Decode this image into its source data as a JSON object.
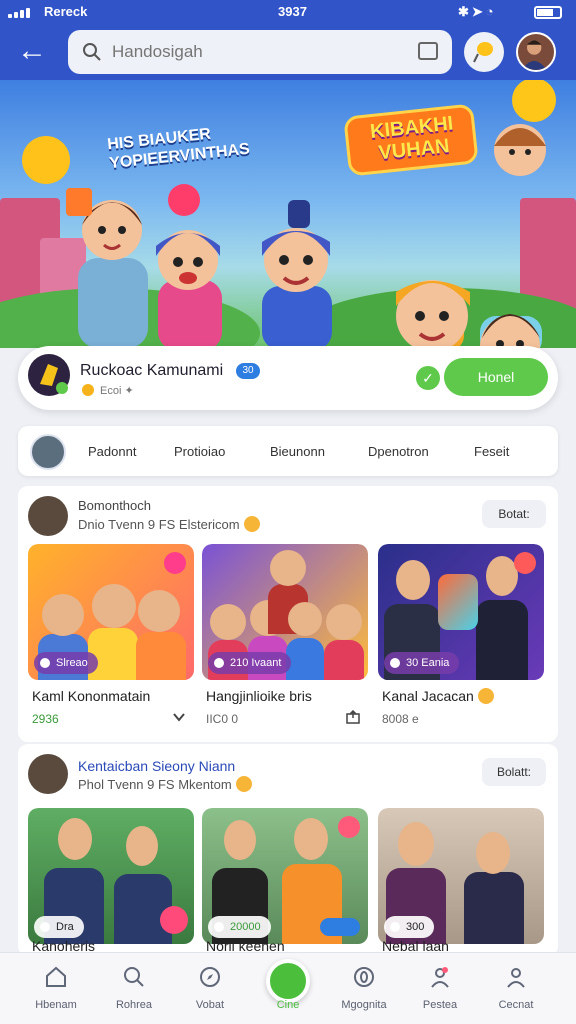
{
  "status_bar": {
    "carrier": "Rereck",
    "time": "3937"
  },
  "header": {
    "search_placeholder": "Handosigah"
  },
  "banner": {
    "promo_text": "HIS BIAUKER\nYOPIEERVINTHAS",
    "logo_text": "KIBAKHI\nVUHAN"
  },
  "channel": {
    "name": "Ruckoac Kamunami",
    "badge": "30",
    "subtitle": "Ecoi ✦",
    "follow_label": "Honel"
  },
  "tabs": [
    "Padonnt",
    "Protioiao",
    "Bieunonn",
    "Dpenotron",
    "Feseit"
  ],
  "feed": [
    {
      "title": "Bomonthoch",
      "subtitle": "Dnio Tvenn 9 FS Elstericom",
      "action": "Botat:",
      "videos": [
        {
          "badge": "Slreao",
          "title": "Kaml Kononmatain",
          "meta": "2936",
          "meta_color": "#3a9b3a"
        },
        {
          "badge": "210 Ivaant",
          "title": "Hangjinlioike bris",
          "meta": "IIC0 0",
          "meta_color": "#666666"
        },
        {
          "badge": "30 Eania",
          "title": "Kanal Jacacan",
          "meta": "8008 e",
          "meta_color": "#666666"
        }
      ]
    },
    {
      "title": "Kentaicban Sieony Niann",
      "subtitle": "Phol Tvenn 9 FS Mkentom",
      "action": "Bolatt:",
      "videos": [
        {
          "badge": "Dra",
          "title": "Kanoheris",
          "meta": "",
          "meta_color": "#3a9b3a"
        },
        {
          "badge": "20000",
          "title": "Noril keenen",
          "meta": "",
          "meta_color": "#666666"
        },
        {
          "badge": "300",
          "title": "Nebal laan",
          "meta": "",
          "meta_color": "#666666"
        }
      ]
    }
  ],
  "bottom_nav": [
    {
      "label": "Hbenam",
      "icon": "home-icon"
    },
    {
      "label": "Rohrea",
      "icon": "search-icon"
    },
    {
      "label": "Vobat",
      "icon": "compass-icon"
    },
    {
      "label": "Cine",
      "icon": "play-icon"
    },
    {
      "label": "Mgognita",
      "icon": "coin-icon"
    },
    {
      "label": "Pestea",
      "icon": "heart-person-icon"
    },
    {
      "label": "Cecnat",
      "icon": "profile-icon"
    }
  ],
  "colors": {
    "accent_blue": "#3154c9",
    "accent_green": "#5ec94a",
    "badge_purple": "#7a3caa"
  }
}
